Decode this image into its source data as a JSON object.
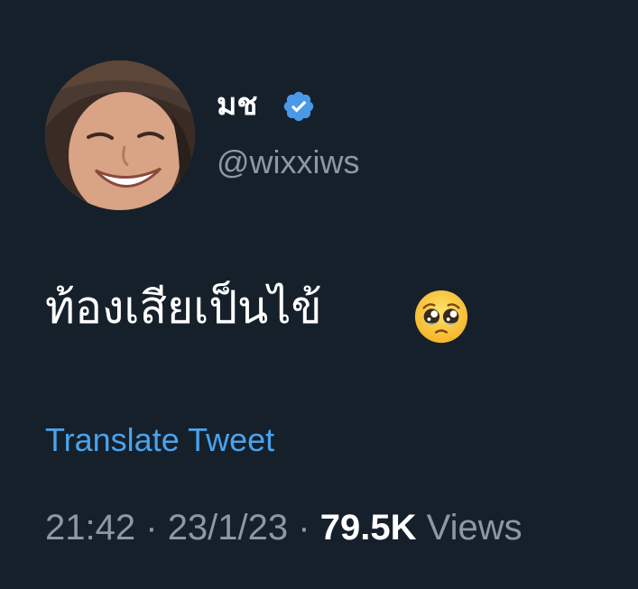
{
  "user": {
    "display_name": "มช",
    "handle": "@wixxiws",
    "verified": true,
    "avatar_icon": "avatar-photo",
    "verified_color": "#4a99e9"
  },
  "tweet": {
    "text": "ท้องเสียเป็นไข้",
    "emoji_icon": "pleading-face-emoji",
    "translate_label": "Translate Tweet"
  },
  "meta": {
    "time": "21:42",
    "separator": "·",
    "date": "23/1/23",
    "views_count": "79.5K",
    "views_label": "Views"
  },
  "colors": {
    "background": "#15202b",
    "link": "#4ba3ec",
    "secondary_text": "#8b98a5",
    "primary_text": "#ffffff"
  }
}
